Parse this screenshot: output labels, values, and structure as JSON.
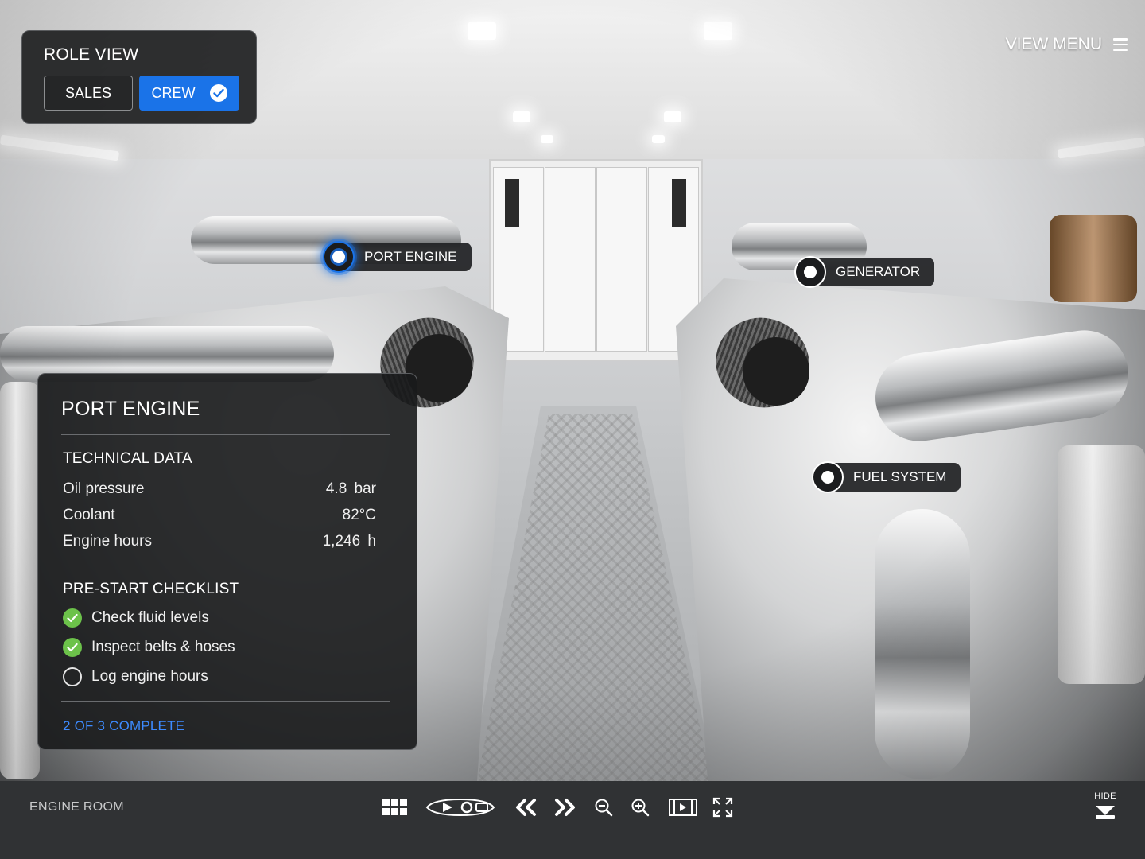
{
  "role_view": {
    "title": "ROLE VIEW",
    "sales_label": "SALES",
    "crew_label": "CREW",
    "selected": "CREW"
  },
  "view_menu": {
    "label": "VIEW MENU",
    "icon": "hamburger-icon"
  },
  "hotspots": [
    {
      "label": "PORT ENGINE",
      "active": true
    },
    {
      "label": "GENERATOR",
      "active": false
    },
    {
      "label": "FUEL SYSTEM",
      "active": false
    }
  ],
  "info_panel": {
    "title": "PORT ENGINE",
    "technical_title": "TECHNICAL DATA",
    "technical": [
      {
        "label": "Oil pressure",
        "value": "4.8 bar"
      },
      {
        "label": "Coolant",
        "value": "82°C"
      },
      {
        "label": "Engine hours",
        "value": "1,246 h"
      }
    ],
    "checklist_title": "PRE-START CHECKLIST",
    "checklist": [
      {
        "label": "Check fluid levels",
        "done": true
      },
      {
        "label": "Inspect belts & hoses",
        "done": true
      },
      {
        "label": "Log engine hours",
        "done": false
      }
    ],
    "progress": "2 OF 3 COMPLETE"
  },
  "toolbar": {
    "location": "ENGINE ROOM",
    "hide_label": "HIDE",
    "icons": [
      "grid-icon",
      "brand-logo-icon",
      "rewind-icon",
      "fast-forward-icon",
      "zoom-out-icon",
      "zoom-in-icon",
      "play-video-icon",
      "fullscreen-icon",
      "hide-arrow-icon"
    ]
  },
  "colors": {
    "accent": "#1a73e8",
    "progress_text": "#3d8bff",
    "check_done": "#6cc24a",
    "panel_bg": "#18191b",
    "toolbar_bg": "#303234"
  }
}
